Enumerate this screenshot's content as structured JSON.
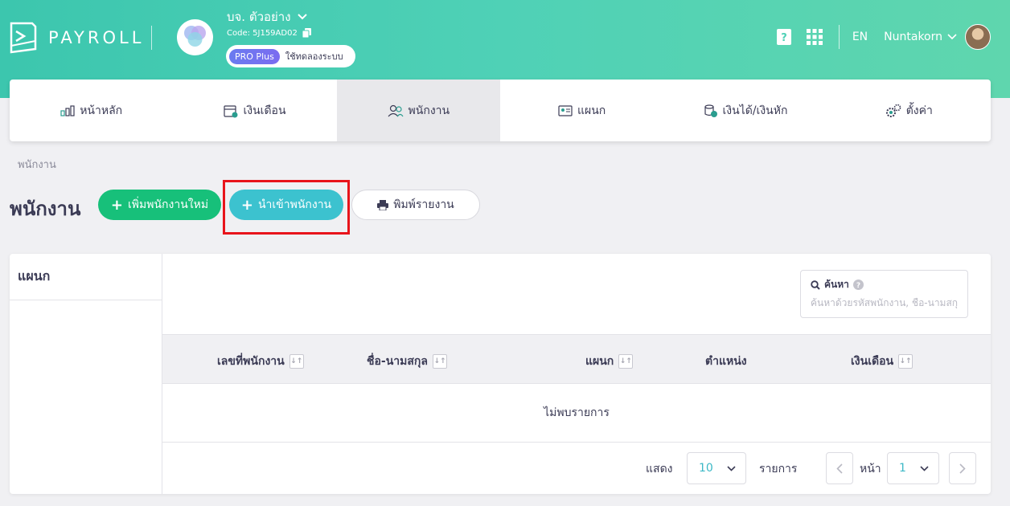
{
  "app": {
    "logo_text": "PAYROLL",
    "company_name": "บจ. ตัวอย่าง",
    "company_code": "Code: 5J159AD02",
    "plan_badge": "PRO Plus",
    "trial_text": "ใช้ทดลองระบบ",
    "language": "EN",
    "username": "Nuntakorn"
  },
  "nav": {
    "items": [
      {
        "label": "หน้าหลัก",
        "icon": "bar-chart-icon",
        "active": false
      },
      {
        "label": "เงินเดือน",
        "icon": "calendar-icon",
        "active": false
      },
      {
        "label": "พนักงาน",
        "icon": "users-icon",
        "active": true
      },
      {
        "label": "แผนก",
        "icon": "id-card-icon",
        "active": false
      },
      {
        "label": "เงินได้/เงินหัก",
        "icon": "coins-icon",
        "active": false
      },
      {
        "label": "ตั้งค่า",
        "icon": "gears-icon",
        "active": false
      }
    ]
  },
  "breadcrumb": "พนักงาน",
  "page": {
    "title": "พนักงาน",
    "add_button": "เพิ่มพนักงานใหม่",
    "import_button": "นำเข้าพนักงาน",
    "print_button": "พิมพ์รายงาน"
  },
  "department_panel": {
    "title": "แผนก"
  },
  "search": {
    "label": "ค้นหา",
    "placeholder": "ค้นหาด้วยรหัสพนักงาน, ชื่อ-นามสกุล"
  },
  "table": {
    "columns": [
      "เลขที่พนักงาน",
      "ชื่อ-นามสกุล",
      "แผนก",
      "ตำแหน่ง",
      "เงินเดือน"
    ],
    "empty_text": "ไม่พบรายการ"
  },
  "pagination": {
    "show_label": "แสดง",
    "page_size": "10",
    "items_label": "รายการ",
    "page_label": "หน้า",
    "current_page": "1"
  },
  "colors": {
    "header_gradient_start": "#3cc6ae",
    "header_gradient_end": "#5fd6ae",
    "add_button": "#17c07a",
    "import_button": "#3cc2cf",
    "highlight_box": "#e8141b"
  }
}
